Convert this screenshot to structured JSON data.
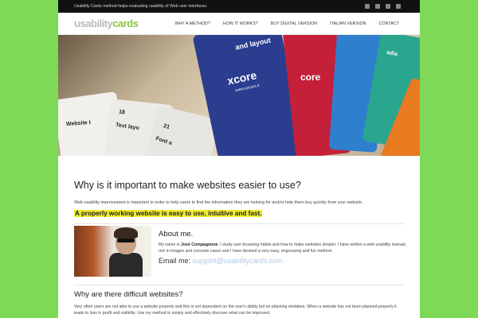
{
  "topbar": {
    "tagline": "Usability Cards method helps evaluating usability of Web user interfaces.",
    "social_icons": [
      "facebook-icon",
      "twitter-icon",
      "youtube-icon",
      "linkedin-icon"
    ]
  },
  "header": {
    "logo_part1": "usability",
    "logo_part2": "cards",
    "nav": [
      "WHY A METHOD?",
      "HOW IT WORKS?",
      "BUY DIGITAL VERSION",
      "ITALIAN VERSION",
      "CONTACT"
    ]
  },
  "hero": {
    "cards_text": {
      "layout": "and layout",
      "xcore": "xcore",
      "url": "www.uxcore.it",
      "core": "core",
      "edia": "edia",
      "website": "Website t",
      "text_lay": "Text layo",
      "font": "Font a",
      "num_18": "18",
      "num_21": "21"
    }
  },
  "main": {
    "title": "Why is it important to make websites easier to use?",
    "intro": "Web usability improvement is important in order to help users to find the information they are looking for and/or help them buy quickly from your website.",
    "highlight": "A properly working website is easy to use, intuitive and fast.",
    "about": {
      "heading": "About me.",
      "text_before": "My name is ",
      "name": "José Compagnone",
      "text_after": ", I study user browsing habits and how to make websites simpler. I have written a web usability manual, rich in images and concrete cases and I have devised a very easy, engrossing and fun method.",
      "email_label": "Email me:",
      "email": "support@usabilitycards.com"
    },
    "why": {
      "heading": "Why are there difficult websites?",
      "text": "Very often users are not able to use a website properly and this is not dependent on the user's ability but on planning mistakes. When a website has not been planned properly it leads to loss in profit and visibility. Use my method to simply and effectively discover what can be improved."
    }
  },
  "colors": {
    "background": "#7ed957",
    "accent": "#8dc63f",
    "highlight": "#f0ea2e",
    "email_link": "#aec7e0"
  }
}
